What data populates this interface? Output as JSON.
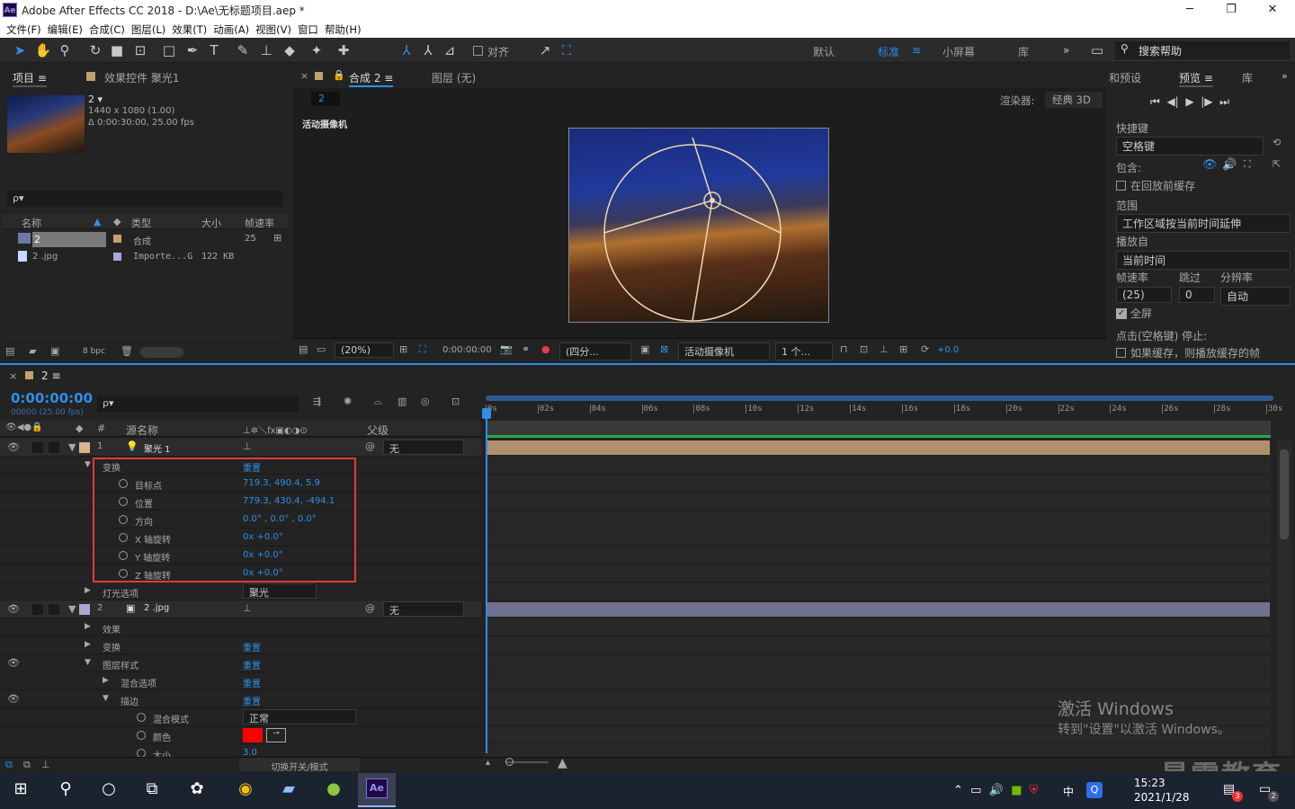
{
  "window": {
    "title": "Adobe After Effects CC 2018 - D:\\Ae\\无标题项目.aep *",
    "logo": "Ae",
    "min": "─",
    "max": "❐",
    "close": "✕"
  },
  "menu": [
    "文件(F)",
    "编辑(E)",
    "合成(C)",
    "图层(L)",
    "效果(T)",
    "动画(A)",
    "视图(V)",
    "窗口",
    "帮助(H)"
  ],
  "toolbar": {
    "align_label": "对齐",
    "workspaces": [
      "默认",
      "标准",
      "小屏幕",
      "库"
    ],
    "active_ws": "标准",
    "more": "»",
    "search": "搜索帮助"
  },
  "project": {
    "tab": "项目",
    "effects_tab": "效果控件 聚光1",
    "comp_name": "2 ▾",
    "comp_res": "1440 x 1080 (1.00)",
    "comp_dur": "Δ 0:00:30:00, 25.00 fps",
    "search_placeholder": "ρ▾",
    "cols": [
      "名称",
      "类型",
      "大小",
      "帧速率"
    ],
    "items": [
      {
        "name": "2",
        "type": "合成",
        "size": "",
        "fps": "25"
      },
      {
        "name": "2 .jpg",
        "type": "Importe...G",
        "size": "122 KB",
        "fps": ""
      }
    ],
    "bpc": "8 bpc"
  },
  "comp": {
    "tab": "合成 2",
    "layer_tab": "图层 (无)",
    "crumb": "2",
    "renderer_label": "渲染器:",
    "renderer": "经典 3D",
    "camera_label": "活动摄像机",
    "footer": {
      "zoom": "(20%)",
      "time": "0:00:00:00",
      "res": "(四分...",
      "view": "活动摄像机",
      "views": "1 个...",
      "exposure": "+0.0"
    }
  },
  "preview": {
    "tab1": "和预设",
    "tab2": "预览",
    "tab3": "库",
    "shortcut_label": "快捷键",
    "shortcut": "空格键",
    "include_label": "包含:",
    "cache_label": "在回放前缓存",
    "range_label": "范围",
    "range": "工作区域按当前时间延伸",
    "play_from_label": "播放自",
    "play_from": "当前时间",
    "fps_label": "帧速率",
    "skip_label": "跳过",
    "res_label": "分辨率",
    "fps": "(25)",
    "skip": "0",
    "res": "自动",
    "full_label": "全屏",
    "stop_label": "点击(空格键) 停止:",
    "cached_label": "如果缓存，则播放缓存的帧"
  },
  "timeline": {
    "tab": "2",
    "timecode": "0:00:00:00",
    "frames": "00000 (25.00 fps)",
    "search_placeholder": "ρ▾",
    "cols": {
      "num": "#",
      "name": "源名称",
      "parent": "父级"
    },
    "ruler": [
      "0s",
      "02s",
      "04s",
      "06s",
      "08s",
      "10s",
      "12s",
      "14s",
      "16s",
      "18s",
      "20s",
      "22s",
      "24s",
      "26s",
      "28s",
      "30s"
    ],
    "layers": [
      {
        "row": 0,
        "kind": "layer",
        "num": "1",
        "name": "聚光 1",
        "parent": "无",
        "color": "#d9b48c"
      },
      {
        "row": 1,
        "kind": "group",
        "name": "变换",
        "value": "重置",
        "indent": 1
      },
      {
        "row": 2,
        "kind": "prop",
        "name": "目标点",
        "value": "719.3, 490.4, 5.9"
      },
      {
        "row": 3,
        "kind": "prop",
        "name": "位置",
        "value": "779.3, 430.4, -494.1"
      },
      {
        "row": 4,
        "kind": "prop",
        "name": "方向",
        "value": "0.0° , 0.0° , 0.0°"
      },
      {
        "row": 5,
        "kind": "prop",
        "name": "X 轴旋转",
        "value": "0x +0.0°"
      },
      {
        "row": 6,
        "kind": "prop",
        "name": "Y 轴旋转",
        "value": "0x +0.0°"
      },
      {
        "row": 7,
        "kind": "prop",
        "name": "Z 轴旋转",
        "value": "0x +0.0°"
      },
      {
        "row": 8,
        "kind": "group2",
        "name": "灯光选项",
        "value": "聚光"
      },
      {
        "row": 9,
        "kind": "layer",
        "num": "2",
        "name": "2 .jpg",
        "parent": "无",
        "color": "#a8a8d8"
      },
      {
        "row": 10,
        "kind": "sub",
        "name": "效果",
        "value": ""
      },
      {
        "row": 11,
        "kind": "sub",
        "name": "变换",
        "value": "重置"
      },
      {
        "row": 12,
        "kind": "subopen",
        "name": "图层样式",
        "value": "重置"
      },
      {
        "row": 13,
        "kind": "sub2",
        "name": "混合选项",
        "value": "重置"
      },
      {
        "row": 14,
        "kind": "sub2open",
        "name": "描边",
        "value": "重置"
      },
      {
        "row": 15,
        "kind": "prop2",
        "name": "混合模式",
        "value": "正常"
      },
      {
        "row": 16,
        "kind": "prop2",
        "name": "颜色",
        "value": ""
      },
      {
        "row": 17,
        "kind": "prop2",
        "name": "大小",
        "value": "3.0"
      }
    ],
    "footer": "切换开关/模式"
  },
  "watermark": {
    "line1": "激活 Windows",
    "line2": "转到\"设置\"以激活 Windows。",
    "brand": "最需教育"
  },
  "taskbar": {
    "time": "15:23",
    "date": "2021/1/28",
    "ime": "中",
    "notif": "2",
    "badge": "3"
  },
  "colors": {
    "accent": "#2e8fe8",
    "highlight": "#e0393e",
    "spot_layer": "#b0906a",
    "img_layer": "#707090",
    "stroke_color": "#ff0000"
  }
}
